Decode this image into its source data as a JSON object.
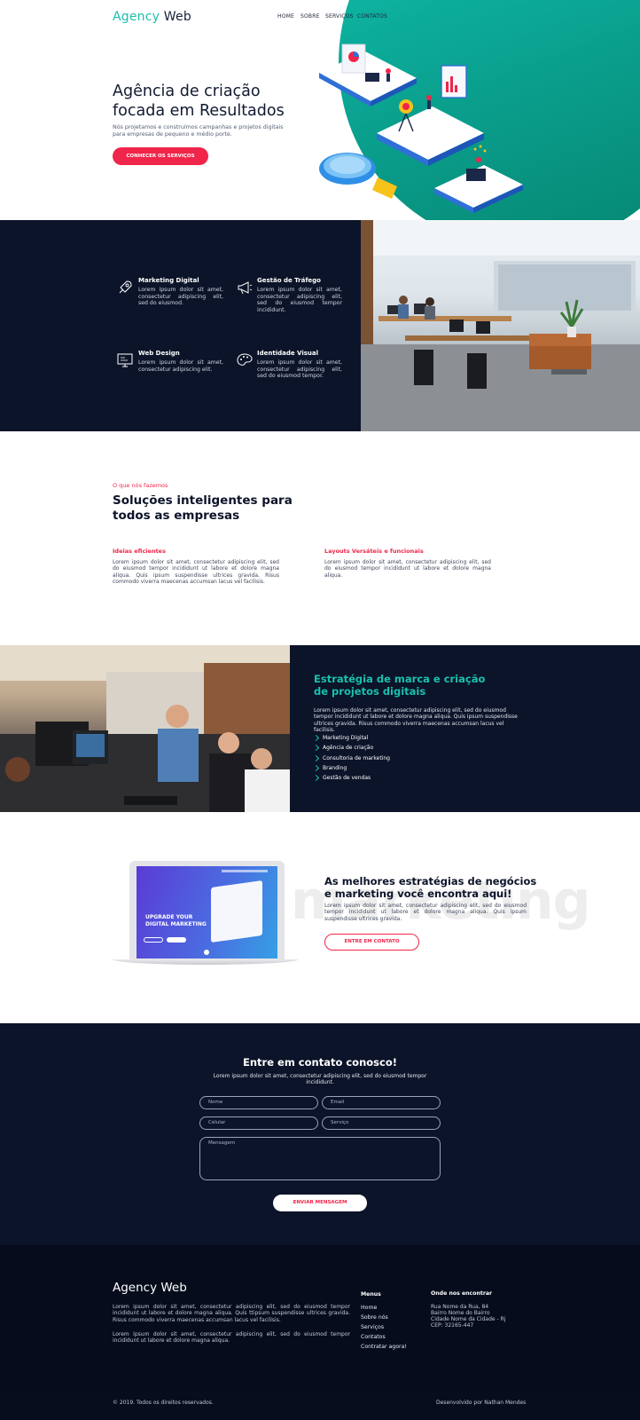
{
  "header": {
    "logo_accent": "Agency",
    "logo_rest": "Web",
    "nav": [
      "HOME",
      "SOBRE",
      "SERVIÇOS",
      "CONTATOS"
    ]
  },
  "hero": {
    "title": "Agência de criação focada em Resultados",
    "subtitle": "Nós projetamos e construímos campanhas e projetos digitais para empresas de pequeno e médio porte.",
    "cta": "CONHECER OS SERVIÇOS"
  },
  "services": [
    {
      "title": "Marketing Digital",
      "desc": "Lorem ipsum dolor sit amet, consectetur adipiscing elit, sed do eiusmod.",
      "icon": "rocket-icon"
    },
    {
      "title": "Gestão de Tráfego",
      "desc": "Lorem ipsum dolor sit amet, consectetur adipiscing elit, sed do eiusmod tempor incididunt.",
      "icon": "megaphone-icon"
    },
    {
      "title": "Web Design",
      "desc": "Lorem ipsum dolor sit amet, consectetur adipiscing elit.",
      "icon": "monitor-icon"
    },
    {
      "title": "Identidade Visual",
      "desc": "Lorem ipsum dolor sit amet, consectetur adipiscing elit, sed do eiusmod tempor.",
      "icon": "palette-icon"
    }
  ],
  "what_we_do": {
    "kicker": "O que nós fazemos",
    "title": "Soluções inteligentes para todos as empresas",
    "col1_title": "Ideias eficientes",
    "col1_text": "Lorem ipsum dolor sit amet, consectetur adipiscing elit, sed do eiusmod tempor incididunt ut labore et dolore magna aliqua. Quis ipsum suspendisse ultrices gravida. Risus commodo viverra maecenas accumsan lacus vel facilisis.",
    "col2_title": "Layouts Versáteis e funcionais",
    "col2_text": "Lorem ipsum dolor sit amet, consectetur adipiscing elit, sed do eiusmod tempor incididunt ut labore et dolore magna aliqua."
  },
  "strategy": {
    "title": "Estratégia de marca e criação de projetos digitais",
    "desc": "Lorem ipsum dolor sit amet, consectetur adipiscing elit, sed do eiusmod tempor incididunt ut labore et dolore magna aliqua. Quis ipsum suspendisse ultrices gravida. Risus commodo viverra maecenas accumsan lacus vel facilisis.",
    "items": [
      "Marketing Digital",
      "Agência de criação",
      "Consultoria de marketing",
      "Branding",
      "Gestão de vendas"
    ]
  },
  "marketing": {
    "watermark": "marketing",
    "title": "As melhores estratégias de negócios e marketing você encontra aqui!",
    "desc": "Lorem ipsum dolor sit amet, consectetur adipiscing elit, sed do eiusmod tempor incididunt ut labore et dolore magna aliqua. Quis ipsum suspendisse ultrices gravida.",
    "cta": "ENTRE EM CONTATO",
    "mock_headline": "UPGRADE YOUR DIGITAL MARKETING"
  },
  "contact": {
    "title": "Entre em contato conosco!",
    "subtitle": "Lorem ipsum dolor sit amet, consectetur adipiscing elit, sed do eiusmod tempor incididunt.",
    "name_ph": "Nome",
    "email_ph": "Email",
    "phone_ph": "Celular",
    "service_ph": "Serviço",
    "message_ph": "Mensagem",
    "submit": "ENVIAR MENSAGEM"
  },
  "footer": {
    "logo_accent": "Agency",
    "logo_rest": "Web",
    "desc1": "Lorem ipsum dolor sit amet, consectetur adipiscing elit, sed do eiusmod tempor incididunt ut labore et dolore magna aliqua. Quis ttipsum suspendisse ultrices gravida. Risus commodo viverra maecenas accumsan lacus vel facilisis.",
    "desc2": "Lorem ipsum dolor sit amet, consectetur adipiscing elit, sed do eiusmod tempor incididunt ut labore et dolore magna aliqua.",
    "menus_title": "Menus",
    "menus": [
      "Home",
      "Sobre nós",
      "Serviços",
      "Contatos",
      "Contratar agora!"
    ],
    "where_title": "Onde nos encontrar",
    "address": [
      "Rua Nome da Rua, 84",
      "Bairro Nome do Bairro",
      "Cidade Nome da Cidade - Rj",
      "CEP: 32165-447"
    ],
    "copyright": "© 2019. Todos os direitos reservados.",
    "credit": "Desenvolvido por Nathan Mendes"
  }
}
